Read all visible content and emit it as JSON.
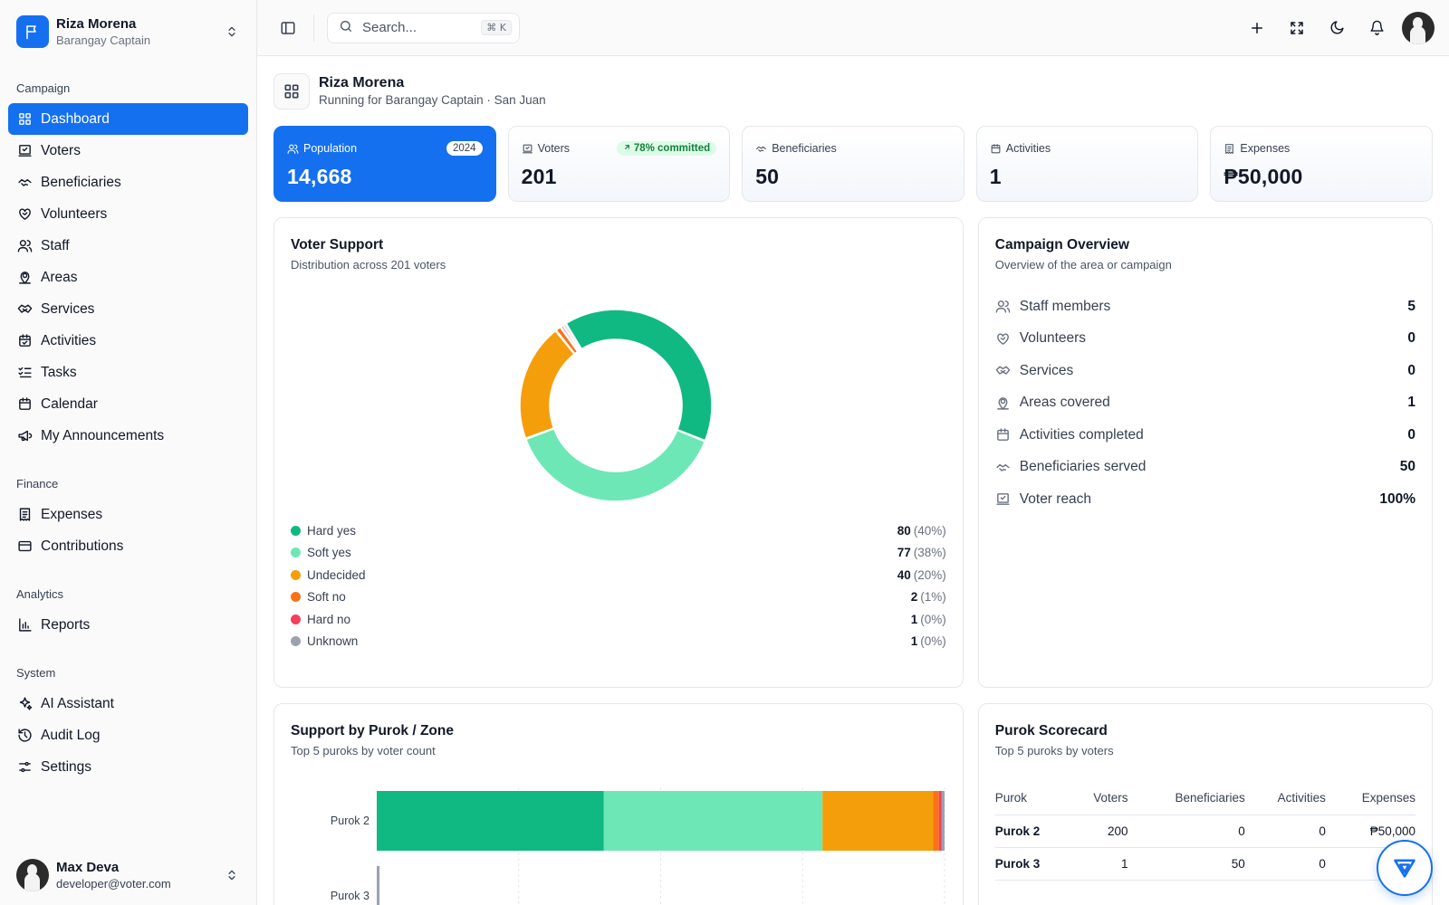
{
  "sidebar": {
    "org_name": "Riza Morena",
    "org_role": "Barangay Captain",
    "sections": {
      "campaign": "Campaign",
      "finance": "Finance",
      "analytics": "Analytics",
      "system": "System"
    },
    "campaign_items": [
      {
        "label": "Dashboard",
        "icon": "grid-icon",
        "active": true
      },
      {
        "label": "Voters",
        "icon": "ballot-icon"
      },
      {
        "label": "Beneficiaries",
        "icon": "handshake-icon"
      },
      {
        "label": "Volunteers",
        "icon": "heart-handshake-icon"
      },
      {
        "label": "Staff",
        "icon": "users-icon"
      },
      {
        "label": "Areas",
        "icon": "map-pin-icon"
      },
      {
        "label": "Services",
        "icon": "handshake-alt-icon"
      },
      {
        "label": "Activities",
        "icon": "calendar-check-icon"
      },
      {
        "label": "Tasks",
        "icon": "list-checks-icon"
      },
      {
        "label": "Calendar",
        "icon": "calendar-icon"
      },
      {
        "label": "My Announcements",
        "icon": "megaphone-icon"
      }
    ],
    "finance_items": [
      {
        "label": "Expenses",
        "icon": "receipt-icon"
      },
      {
        "label": "Contributions",
        "icon": "wallet-icon"
      }
    ],
    "analytics_items": [
      {
        "label": "Reports",
        "icon": "bar-chart-icon"
      }
    ],
    "system_items": [
      {
        "label": "AI Assistant",
        "icon": "sparkles-icon"
      },
      {
        "label": "Audit Log",
        "icon": "history-icon"
      },
      {
        "label": "Settings",
        "icon": "sliders-icon"
      }
    ],
    "user": {
      "name": "Max Deva",
      "email": "developer@voter.com"
    }
  },
  "topbar": {
    "search_placeholder": "Search...",
    "search_shortcut": "⌘ K"
  },
  "page": {
    "name": "Riza Morena",
    "subtitle": "Running for Barangay Captain · San Juan"
  },
  "stats": [
    {
      "label": "Population",
      "value": "14,668",
      "badge": "2024",
      "icon": "users-icon"
    },
    {
      "label": "Voters",
      "value": "201",
      "badge": "78% committed",
      "icon": "ballot-icon"
    },
    {
      "label": "Beneficiaries",
      "value": "50",
      "icon": "handshake-icon"
    },
    {
      "label": "Activities",
      "value": "1",
      "icon": "calendar-icon"
    },
    {
      "label": "Expenses",
      "value": "₱50,000",
      "icon": "receipt-icon"
    }
  ],
  "voter_support": {
    "title": "Voter Support",
    "subtitle": "Distribution across 201 voters",
    "colors": [
      "#10b981",
      "#6ee7b7",
      "#f59e0b",
      "#f97316",
      "#f43f5e",
      "#9ca3af"
    ]
  },
  "chart_data": [
    {
      "type": "pie",
      "title": "Voter Support",
      "categories": [
        "Hard yes",
        "Soft yes",
        "Undecided",
        "Soft no",
        "Hard no",
        "Unknown"
      ],
      "values": [
        80,
        77,
        40,
        2,
        1,
        1
      ],
      "percent_labels": [
        "(40%)",
        "(38%)",
        "(20%)",
        "(1%)",
        "(0%)",
        "(0%)"
      ]
    },
    {
      "type": "bar",
      "title": "Support by Purok / Zone",
      "orientation": "horizontal",
      "stacked": true,
      "categories": [
        "Purok 2",
        "Purok 3"
      ],
      "series": [
        {
          "name": "Hard yes",
          "values": [
            80,
            0
          ]
        },
        {
          "name": "Soft yes",
          "values": [
            77,
            0
          ]
        },
        {
          "name": "Undecided",
          "values": [
            39,
            0
          ]
        },
        {
          "name": "Soft no",
          "values": [
            2,
            0
          ]
        },
        {
          "name": "Hard no",
          "values": [
            1,
            0
          ]
        },
        {
          "name": "Unknown",
          "values": [
            1,
            1
          ]
        }
      ]
    }
  ],
  "campaign_overview": {
    "title": "Campaign Overview",
    "subtitle": "Overview of the area or campaign",
    "items": [
      {
        "label": "Staff members",
        "value": "5",
        "icon": "users-icon"
      },
      {
        "label": "Volunteers",
        "value": "0",
        "icon": "heart-handshake-icon"
      },
      {
        "label": "Services",
        "value": "0",
        "icon": "handshake-alt-icon"
      },
      {
        "label": "Areas covered",
        "value": "1",
        "icon": "map-pin-icon"
      },
      {
        "label": "Activities completed",
        "value": "0",
        "icon": "calendar-icon"
      },
      {
        "label": "Beneficiaries served",
        "value": "50",
        "icon": "handshake-icon"
      },
      {
        "label": "Voter reach",
        "value": "100%",
        "icon": "ballot-icon"
      }
    ]
  },
  "purok_zone": {
    "title": "Support by Purok / Zone",
    "subtitle": "Top 5 puroks by voter count"
  },
  "scorecard": {
    "title": "Purok Scorecard",
    "subtitle": "Top 5 puroks by voters",
    "headers": [
      "Purok",
      "Voters",
      "Beneficiaries",
      "Activities",
      "Expenses"
    ],
    "rows": [
      [
        "Purok 2",
        "200",
        "0",
        "0",
        "₱50,000"
      ],
      [
        "Purok 3",
        "1",
        "50",
        "0",
        ""
      ]
    ]
  }
}
